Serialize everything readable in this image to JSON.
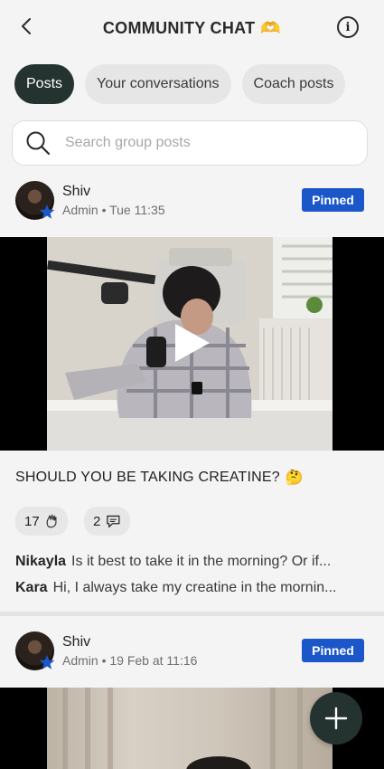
{
  "header": {
    "title": "COMMUNITY CHAT",
    "title_emoji": "🫶",
    "back_icon": "chevron-left-icon",
    "info_icon": "info-icon",
    "info_glyph": "i"
  },
  "tabs": [
    {
      "label": "Posts",
      "active": true
    },
    {
      "label": "Your conversations",
      "active": false
    },
    {
      "label": "Coach posts",
      "active": false
    }
  ],
  "search": {
    "placeholder": "Search group posts"
  },
  "posts": [
    {
      "author": "Shiv",
      "meta": "Admin • Tue 11:35",
      "badge": "Pinned",
      "title": "SHOULD YOU BE TAKING CREATINE?",
      "title_emoji": "🤔",
      "reactions": {
        "count": "17",
        "icon": "clapping-hands-icon"
      },
      "comments": {
        "count": "2",
        "icon": "comment-bubble-icon"
      },
      "comment_previews": [
        {
          "name": "Nikayla",
          "text": "Is it best to take it in the morning? Or if..."
        },
        {
          "name": "Kara",
          "text": "Hi, I always take my creatine in the mornin..."
        }
      ]
    },
    {
      "author": "Shiv",
      "meta": "Admin • 19 Feb at 11:16",
      "badge": "Pinned"
    }
  ],
  "fab": {
    "icon": "plus-icon"
  },
  "colors": {
    "accent_dark": "#24332f",
    "pinned_blue": "#1b57c9",
    "background": "#f4f4f4"
  }
}
